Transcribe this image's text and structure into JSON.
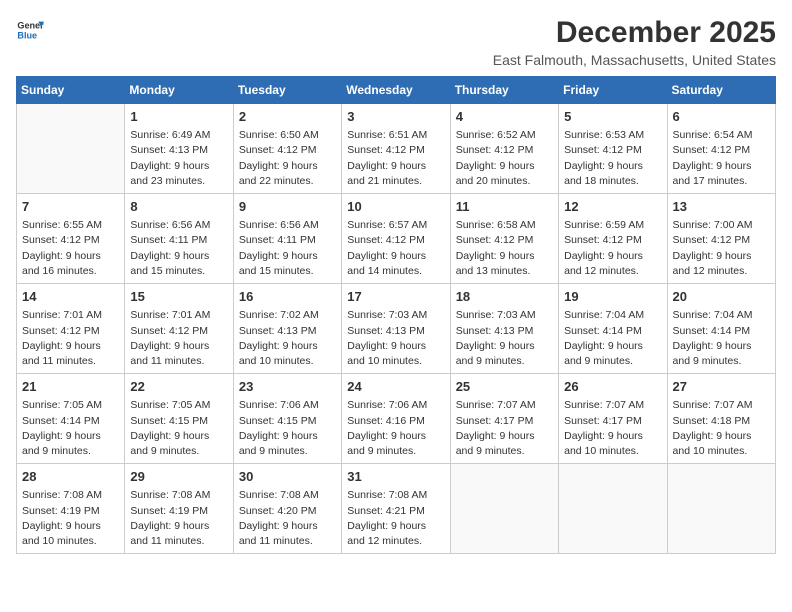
{
  "logo": {
    "line1": "General",
    "line2": "Blue"
  },
  "title": "December 2025",
  "subtitle": "East Falmouth, Massachusetts, United States",
  "days_of_week": [
    "Sunday",
    "Monday",
    "Tuesday",
    "Wednesday",
    "Thursday",
    "Friday",
    "Saturday"
  ],
  "weeks": [
    [
      {
        "day": "",
        "info": ""
      },
      {
        "day": "1",
        "info": "Sunrise: 6:49 AM\nSunset: 4:13 PM\nDaylight: 9 hours\nand 23 minutes."
      },
      {
        "day": "2",
        "info": "Sunrise: 6:50 AM\nSunset: 4:12 PM\nDaylight: 9 hours\nand 22 minutes."
      },
      {
        "day": "3",
        "info": "Sunrise: 6:51 AM\nSunset: 4:12 PM\nDaylight: 9 hours\nand 21 minutes."
      },
      {
        "day": "4",
        "info": "Sunrise: 6:52 AM\nSunset: 4:12 PM\nDaylight: 9 hours\nand 20 minutes."
      },
      {
        "day": "5",
        "info": "Sunrise: 6:53 AM\nSunset: 4:12 PM\nDaylight: 9 hours\nand 18 minutes."
      },
      {
        "day": "6",
        "info": "Sunrise: 6:54 AM\nSunset: 4:12 PM\nDaylight: 9 hours\nand 17 minutes."
      }
    ],
    [
      {
        "day": "7",
        "info": "Sunrise: 6:55 AM\nSunset: 4:12 PM\nDaylight: 9 hours\nand 16 minutes."
      },
      {
        "day": "8",
        "info": "Sunrise: 6:56 AM\nSunset: 4:11 PM\nDaylight: 9 hours\nand 15 minutes."
      },
      {
        "day": "9",
        "info": "Sunrise: 6:56 AM\nSunset: 4:11 PM\nDaylight: 9 hours\nand 15 minutes."
      },
      {
        "day": "10",
        "info": "Sunrise: 6:57 AM\nSunset: 4:12 PM\nDaylight: 9 hours\nand 14 minutes."
      },
      {
        "day": "11",
        "info": "Sunrise: 6:58 AM\nSunset: 4:12 PM\nDaylight: 9 hours\nand 13 minutes."
      },
      {
        "day": "12",
        "info": "Sunrise: 6:59 AM\nSunset: 4:12 PM\nDaylight: 9 hours\nand 12 minutes."
      },
      {
        "day": "13",
        "info": "Sunrise: 7:00 AM\nSunset: 4:12 PM\nDaylight: 9 hours\nand 12 minutes."
      }
    ],
    [
      {
        "day": "14",
        "info": "Sunrise: 7:01 AM\nSunset: 4:12 PM\nDaylight: 9 hours\nand 11 minutes."
      },
      {
        "day": "15",
        "info": "Sunrise: 7:01 AM\nSunset: 4:12 PM\nDaylight: 9 hours\nand 11 minutes."
      },
      {
        "day": "16",
        "info": "Sunrise: 7:02 AM\nSunset: 4:13 PM\nDaylight: 9 hours\nand 10 minutes."
      },
      {
        "day": "17",
        "info": "Sunrise: 7:03 AM\nSunset: 4:13 PM\nDaylight: 9 hours\nand 10 minutes."
      },
      {
        "day": "18",
        "info": "Sunrise: 7:03 AM\nSunset: 4:13 PM\nDaylight: 9 hours\nand 9 minutes."
      },
      {
        "day": "19",
        "info": "Sunrise: 7:04 AM\nSunset: 4:14 PM\nDaylight: 9 hours\nand 9 minutes."
      },
      {
        "day": "20",
        "info": "Sunrise: 7:04 AM\nSunset: 4:14 PM\nDaylight: 9 hours\nand 9 minutes."
      }
    ],
    [
      {
        "day": "21",
        "info": "Sunrise: 7:05 AM\nSunset: 4:14 PM\nDaylight: 9 hours\nand 9 minutes."
      },
      {
        "day": "22",
        "info": "Sunrise: 7:05 AM\nSunset: 4:15 PM\nDaylight: 9 hours\nand 9 minutes."
      },
      {
        "day": "23",
        "info": "Sunrise: 7:06 AM\nSunset: 4:15 PM\nDaylight: 9 hours\nand 9 minutes."
      },
      {
        "day": "24",
        "info": "Sunrise: 7:06 AM\nSunset: 4:16 PM\nDaylight: 9 hours\nand 9 minutes."
      },
      {
        "day": "25",
        "info": "Sunrise: 7:07 AM\nSunset: 4:17 PM\nDaylight: 9 hours\nand 9 minutes."
      },
      {
        "day": "26",
        "info": "Sunrise: 7:07 AM\nSunset: 4:17 PM\nDaylight: 9 hours\nand 10 minutes."
      },
      {
        "day": "27",
        "info": "Sunrise: 7:07 AM\nSunset: 4:18 PM\nDaylight: 9 hours\nand 10 minutes."
      }
    ],
    [
      {
        "day": "28",
        "info": "Sunrise: 7:08 AM\nSunset: 4:19 PM\nDaylight: 9 hours\nand 10 minutes."
      },
      {
        "day": "29",
        "info": "Sunrise: 7:08 AM\nSunset: 4:19 PM\nDaylight: 9 hours\nand 11 minutes."
      },
      {
        "day": "30",
        "info": "Sunrise: 7:08 AM\nSunset: 4:20 PM\nDaylight: 9 hours\nand 11 minutes."
      },
      {
        "day": "31",
        "info": "Sunrise: 7:08 AM\nSunset: 4:21 PM\nDaylight: 9 hours\nand 12 minutes."
      },
      {
        "day": "",
        "info": ""
      },
      {
        "day": "",
        "info": ""
      },
      {
        "day": "",
        "info": ""
      }
    ]
  ]
}
